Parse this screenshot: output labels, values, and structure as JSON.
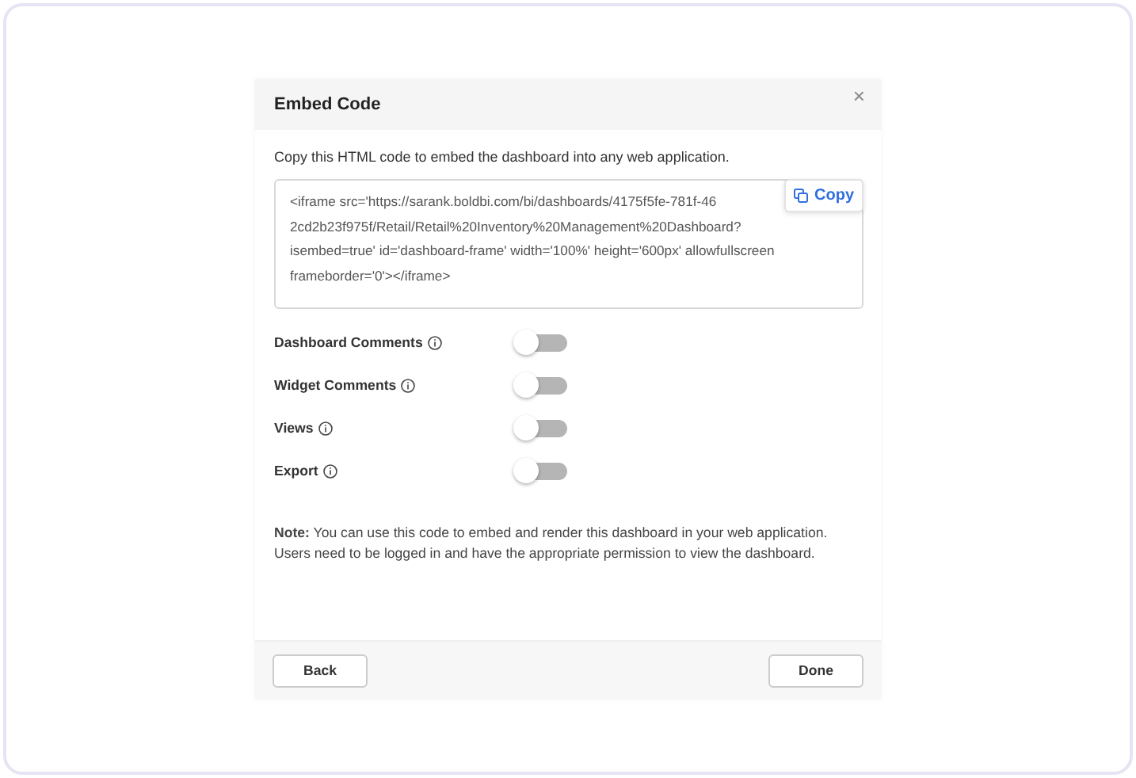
{
  "dialog": {
    "title": "Embed Code",
    "close": "×",
    "instruction": "Copy this HTML code to embed the dashboard into any web application.",
    "code_lines": [
      "<iframe src='https://sarank.boldbi.com/bi/dashboards/4175f5fe-781f-46",
      "2cd2b23f975f/Retail/Retail%20Inventory%20Management%20Dashboard?",
      "isembed=true' id='dashboard-frame' width='100%' height='600px' allowfullscreen",
      "frameborder='0'></iframe>"
    ],
    "copy_button": "Copy",
    "options": [
      {
        "label": "Dashboard Comments",
        "on": false
      },
      {
        "label": "Widget Comments",
        "on": false
      },
      {
        "label": "Views",
        "on": false
      },
      {
        "label": "Export",
        "on": false
      }
    ],
    "note": "**Note:** You can use this code to embed and render this dashboard in your web application. Users need to be logged in and have the appropriate permission to view the dashboard.",
    "buttons": [
      "Back",
      "Done"
    ]
  }
}
